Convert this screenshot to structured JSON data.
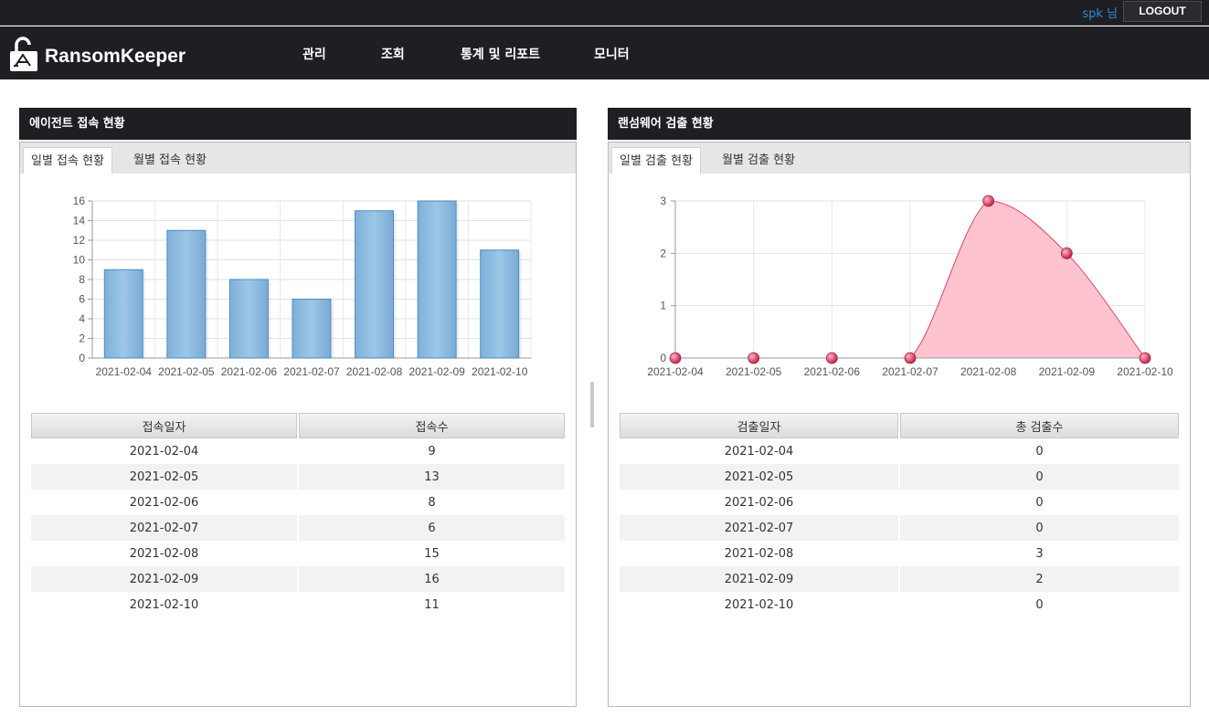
{
  "header": {
    "user_label": "spk 님",
    "logout_label": "LOGOUT",
    "app_name": "RansomKeeper",
    "nav": [
      "관리",
      "조회",
      "통계 및 리포트",
      "모니터"
    ]
  },
  "agent_panel": {
    "title": "에이전트 접속 현황",
    "tabs": [
      "일별 접속 현황",
      "월별 접속 현황"
    ],
    "active_tab": "일별 접속 현황",
    "table": {
      "columns": [
        "접속일자",
        "접속수"
      ],
      "rows": [
        [
          "2021-02-04",
          "9"
        ],
        [
          "2021-02-05",
          "13"
        ],
        [
          "2021-02-06",
          "8"
        ],
        [
          "2021-02-07",
          "6"
        ],
        [
          "2021-02-08",
          "15"
        ],
        [
          "2021-02-09",
          "16"
        ],
        [
          "2021-02-10",
          "11"
        ]
      ]
    }
  },
  "ransom_panel": {
    "title": "랜섬웨어 검출 현황",
    "tabs": [
      "일별 검출 현황",
      "월별 검출 현황"
    ],
    "active_tab": "일별 검출 현황",
    "table": {
      "columns": [
        "검출일자",
        "총 검출수"
      ],
      "rows": [
        [
          "2021-02-04",
          "0"
        ],
        [
          "2021-02-05",
          "0"
        ],
        [
          "2021-02-06",
          "0"
        ],
        [
          "2021-02-07",
          "0"
        ],
        [
          "2021-02-08",
          "3"
        ],
        [
          "2021-02-09",
          "2"
        ],
        [
          "2021-02-10",
          "0"
        ]
      ]
    }
  },
  "chart_data": [
    {
      "type": "bar",
      "categories": [
        "2021-02-04",
        "2021-02-05",
        "2021-02-06",
        "2021-02-07",
        "2021-02-08",
        "2021-02-09",
        "2021-02-10"
      ],
      "values": [
        9,
        13,
        8,
        6,
        15,
        16,
        11
      ],
      "yticks": [
        0,
        2,
        4,
        6,
        8,
        10,
        12,
        14,
        16
      ],
      "ylim": [
        0,
        16
      ],
      "grid": true,
      "color": "#8cb8db"
    },
    {
      "type": "area",
      "categories": [
        "2021-02-04",
        "2021-02-05",
        "2021-02-06",
        "2021-02-07",
        "2021-02-08",
        "2021-02-09",
        "2021-02-10"
      ],
      "values": [
        0,
        0,
        0,
        0,
        3,
        2,
        0
      ],
      "yticks": [
        0,
        1,
        2,
        3
      ],
      "ylim": [
        0,
        3
      ],
      "grid": true,
      "color": "#ffc0cc",
      "line_color": "#e0456a"
    }
  ]
}
